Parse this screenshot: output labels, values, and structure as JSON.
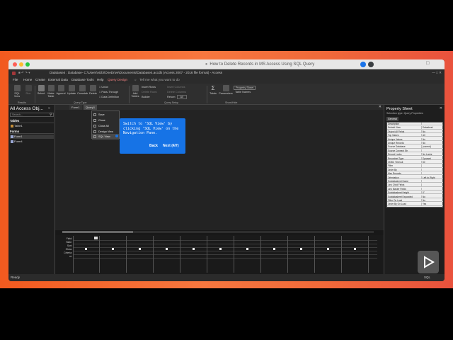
{
  "browser": {
    "url_title": "How to Delete Records in MS Access Using SQL Query"
  },
  "app": {
    "title": "Database4 : Database- C:\\Users\\vizbi\\OneDrive\\Documents\\Database4.accdb (Access 2007 - 2016 file format) - Access",
    "menu": [
      "File",
      "Home",
      "Create",
      "External Data",
      "Database Tools",
      "Help",
      "Query Design"
    ],
    "tell_me": "Tell me what you want to do"
  },
  "ribbon": {
    "results": [
      "SQL View",
      "Run"
    ],
    "results_group": "Results",
    "query_type": [
      "Select",
      "Make Table",
      "Append",
      "Update",
      "Crosstab",
      "Delete"
    ],
    "query_type_small": [
      "Union",
      "Pass-Through",
      "Data Definition"
    ],
    "query_type_group": "Query Type",
    "add_tables": "Add Tables",
    "setup_small": [
      "Insert Rows",
      "Delete Rows",
      "Builder"
    ],
    "setup_small2": [
      "Insert Columns",
      "Delete Columns"
    ],
    "return_label": "Return:",
    "return_value": "All",
    "setup_group": "Query Setup",
    "totals": "Totals",
    "parameters": "Parameters",
    "property_sheet": "Property Sheet",
    "table_names": "Table Names",
    "show_hide_group": "Show/Hide"
  },
  "nav": {
    "title": "All Access Obj...",
    "search_placeholder": "Search...",
    "tables_header": "Tables",
    "tables": [
      "Table1"
    ],
    "forms_header": "Forms",
    "forms": [
      "Form1",
      "Form4"
    ]
  },
  "doc": {
    "tabs": [
      "Form1",
      "Query1"
    ]
  },
  "context_menu": {
    "items": [
      "Save",
      "Close",
      "Close All",
      "Design View",
      "SQL View"
    ]
  },
  "grid_labels": [
    "Field:",
    "Table:",
    "Sort:",
    "Show:",
    "Criteria:",
    "or:"
  ],
  "tooltip": {
    "text": "Switch to 'SQL View' by clicking 'SQL View' on the Navigation Pane.",
    "back": "Back",
    "next": "Next (4/7)"
  },
  "property_sheet": {
    "title": "Property Sheet",
    "selection_type": "Selection type:  Query Properties",
    "tab": "General",
    "rows": [
      [
        "Description",
        ""
      ],
      [
        "Default View",
        "Datasheet"
      ],
      [
        "Output All Fields",
        "No"
      ],
      [
        "Top Values",
        "All"
      ],
      [
        "Unique Values",
        "No"
      ],
      [
        "Unique Records",
        "No"
      ],
      [
        "Source Database",
        "(current)"
      ],
      [
        "Source Connect Str",
        ""
      ],
      [
        "Record Locks",
        "No Locks"
      ],
      [
        "Recordset Type",
        "Dynaset"
      ],
      [
        "ODBC Timeout",
        "60"
      ],
      [
        "Filter",
        ""
      ],
      [
        "Order By",
        ""
      ],
      [
        "Max Records",
        ""
      ],
      [
        "Orientation",
        "Left-to-Right"
      ],
      [
        "Subdatasheet Name",
        ""
      ],
      [
        "Link Child Fields",
        ""
      ],
      [
        "Link Master Fields",
        ""
      ],
      [
        "Subdatasheet Height",
        "0\""
      ],
      [
        "Subdatasheet Expanded",
        "No"
      ],
      [
        "Filter On Load",
        "No"
      ],
      [
        "Order By On Load",
        "Yes"
      ]
    ]
  },
  "status": {
    "left": "Ready",
    "right": "SQL"
  }
}
